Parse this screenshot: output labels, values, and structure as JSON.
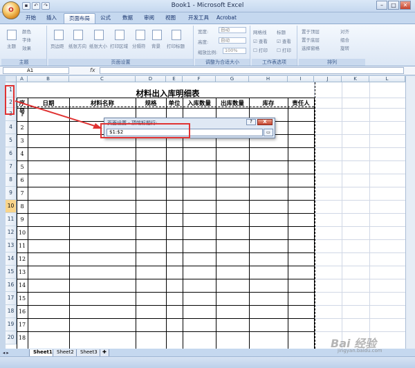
{
  "window": {
    "title": "Book1 - Microsoft Excel",
    "office_button": "O",
    "qat_undo": "↶",
    "qat_redo": "↷",
    "qat_save": "▪",
    "min": "–",
    "restore": "□",
    "close": "✕"
  },
  "tabs": [
    "开始",
    "插入",
    "页面布局",
    "公式",
    "数据",
    "审阅",
    "视图",
    "开发工具",
    "Acrobat"
  ],
  "ribbon": {
    "groups": {
      "theme": "主题",
      "page_setup": "页面设置",
      "scale_to_fit": "调整为合适大小",
      "sheet_options": "工作表选项",
      "arrange": "排列"
    },
    "theme_items": [
      "主题",
      "颜色",
      "字体",
      "效果"
    ],
    "page_items": [
      "页边距",
      "纸张方向",
      "纸张大小",
      "打印区域",
      "分隔符",
      "背景",
      "打印标题"
    ],
    "scale_items": [
      "宽度:",
      "高度:",
      "缩放比例:"
    ],
    "scale_values": [
      "自动",
      "自动",
      "100%"
    ],
    "sheet_gridlines": "网格线",
    "sheet_headings": "标题",
    "sheet_view": "查看",
    "sheet_print": "打印",
    "arrange_items": [
      "置于顶层",
      "置于底层",
      "选择窗格",
      "对齐",
      "组合",
      "旋转"
    ]
  },
  "formula_bar": {
    "name_box": "A1",
    "fx": "fx"
  },
  "sheet": {
    "columns": [
      "A",
      "B",
      "C",
      "D",
      "E",
      "F",
      "G",
      "H",
      "I",
      "J",
      "K",
      "L"
    ],
    "rows": [
      "1",
      "2",
      "3",
      "4",
      "5",
      "6",
      "7",
      "8",
      "9",
      "10",
      "11",
      "12",
      "13",
      "14",
      "15",
      "16",
      "17",
      "18",
      "19",
      "20"
    ],
    "title": "材料出入库明细表",
    "headers": [
      "序号",
      "日期",
      "材料名称",
      "规格",
      "单位",
      "入库数量",
      "出库数量",
      "库存",
      "责任人"
    ],
    "serial_numbers": [
      "1",
      "2",
      "3",
      "4",
      "5",
      "6",
      "7",
      "8",
      "9",
      "10",
      "11",
      "12",
      "13",
      "14",
      "15",
      "16",
      "17",
      "18"
    ]
  },
  "dialog": {
    "title": "页面设置 - 顶端标题行:",
    "value": "$1:$2",
    "help": "?",
    "close": "X",
    "collapse": "▭"
  },
  "sheet_tabs": [
    "Sheet1",
    "Sheet2",
    "Sheet3"
  ],
  "watermark": {
    "brand": "Bai 经验",
    "url": "jingyan.baidu.com"
  },
  "colors": {
    "highlight_row": "#f8d48a",
    "annotation_red": "#e03232"
  }
}
